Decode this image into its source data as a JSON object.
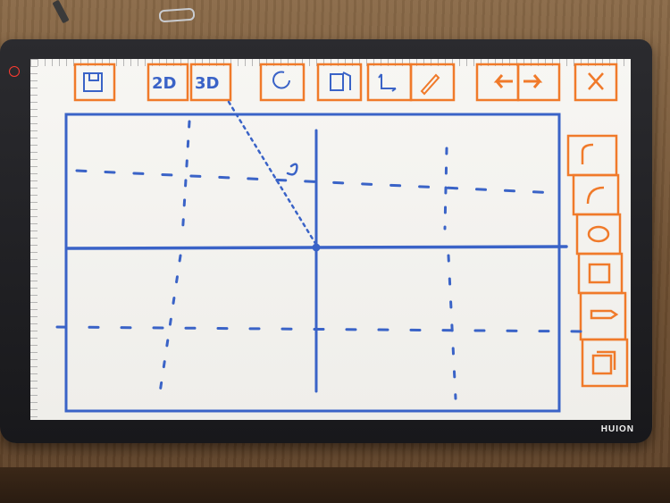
{
  "tablet": {
    "brand": "HUION"
  },
  "toolbar": {
    "buttons": [
      {
        "name": "save-button",
        "icon": "floppy-disk-icon",
        "label": ""
      },
      {
        "name": "2d-button",
        "icon": "",
        "label": "2D"
      },
      {
        "name": "3d-button",
        "icon": "",
        "label": "3D"
      },
      {
        "name": "rotate-button",
        "icon": "rotate-icon",
        "label": ""
      },
      {
        "name": "flip-button",
        "icon": "flip-icon",
        "label": ""
      },
      {
        "name": "axes-button",
        "icon": "axes-icon",
        "label": ""
      },
      {
        "name": "pen-button",
        "icon": "pen-icon",
        "label": ""
      },
      {
        "name": "back-button",
        "icon": "left-arrow-icon",
        "label": ""
      },
      {
        "name": "forward-button",
        "icon": "right-arrow-icon",
        "label": ""
      },
      {
        "name": "close-button",
        "icon": "close-icon",
        "label": ""
      }
    ]
  },
  "side_toolbar": {
    "buttons": [
      {
        "name": "curve-corner-button",
        "icon": "corner-icon"
      },
      {
        "name": "arc-button",
        "icon": "arc-icon"
      },
      {
        "name": "ellipse-button",
        "icon": "ellipse-icon"
      },
      {
        "name": "square-button",
        "icon": "square-icon"
      },
      {
        "name": "pencil-tool-button",
        "icon": "pencil-icon"
      },
      {
        "name": "cube-button",
        "icon": "cube-icon"
      }
    ]
  },
  "colors": {
    "sketch_blue": "#3a63c7",
    "sketch_orange": "#f07a2a"
  }
}
